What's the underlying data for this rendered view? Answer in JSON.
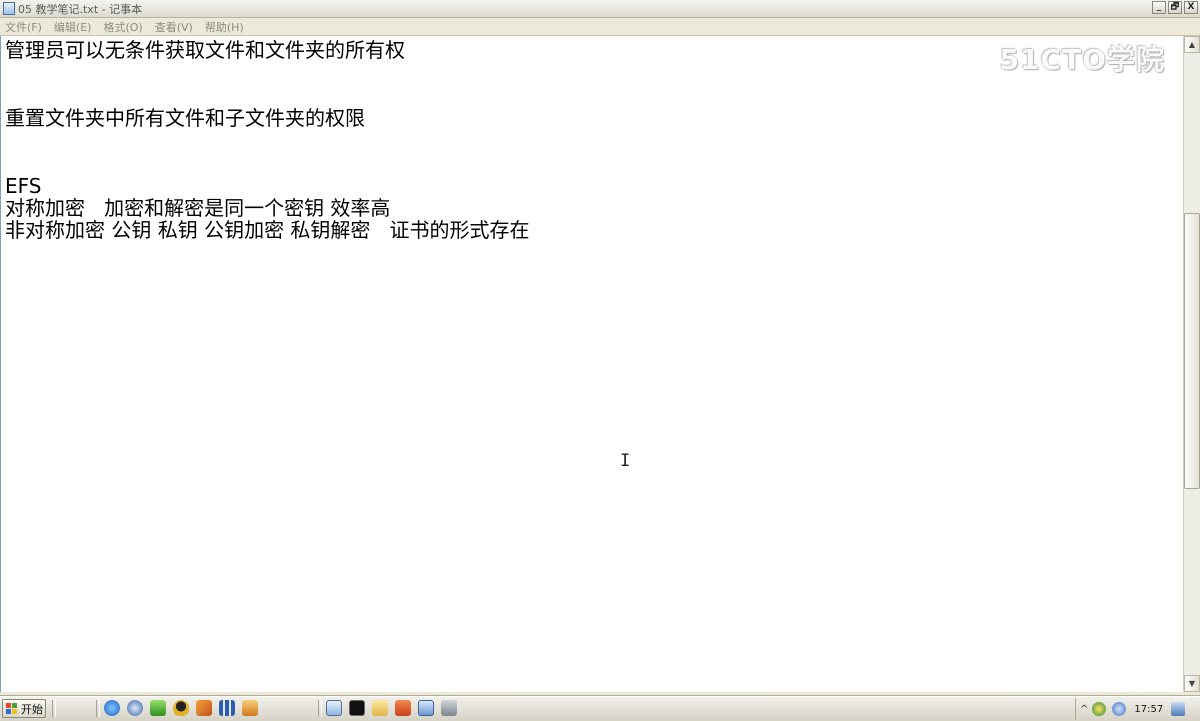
{
  "window": {
    "title": "05 教学笔记.txt - 记事本",
    "buttons": [
      "_",
      "🗗",
      "X"
    ]
  },
  "menu": [
    "文件(F)",
    "编辑(E)",
    "格式(O)",
    "查看(V)",
    "帮助(H)"
  ],
  "document": {
    "lines": [
      "管理员可以无条件获取文件和文件夹的所有权",
      "重置文件夹中所有文件和子文件夹的权限",
      "EFS",
      "对称加密   加密和解密是同一个密钥 效率高",
      "非对称加密 公钥 私钥 公钥加密 私钥解密   证书的形式存在"
    ]
  },
  "watermark": "51CTO学院",
  "scrollbar": {
    "up_arrow": "▲",
    "down_arrow": "▼"
  },
  "taskbar": {
    "start_label": "开始",
    "quick_launch_icons": [
      "ie-icon",
      "media-icon",
      "ie-green-icon",
      "qq-icon",
      "tool-icon",
      "grid-icon",
      "app-icon",
      "notepad-icon",
      "cmd-icon",
      "folder-icon",
      "powerpoint-icon",
      "window-icon",
      "settings-icon"
    ],
    "tray_chevron": "^",
    "clock": "17:57"
  },
  "colors": {
    "window_bg": "#ece9d8",
    "editor_bg": "#ffffff",
    "text": "#000000",
    "start_red": "#e8452b",
    "start_green": "#4aa23a",
    "start_blue": "#2f6fd0",
    "start_yellow": "#f3c21a"
  }
}
